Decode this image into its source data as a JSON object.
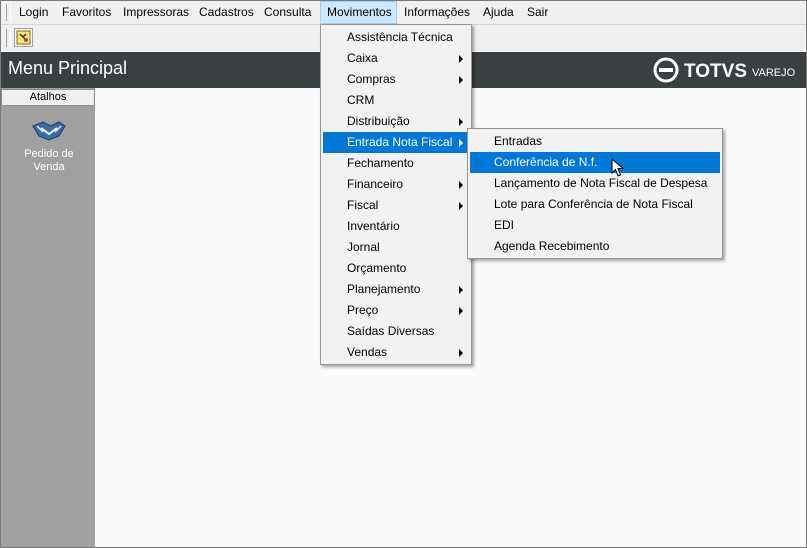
{
  "menubar": [
    {
      "label": "Login",
      "x": 0
    },
    {
      "label": "Favoritos",
      "x": 0
    },
    {
      "label": "Impressoras",
      "x": 0
    },
    {
      "label": "Cadastros",
      "x": 0
    },
    {
      "label": "Consulta",
      "x": 0
    },
    {
      "label": "Movimentos",
      "x": 0
    },
    {
      "label": "Informações",
      "x": 0
    },
    {
      "label": "Ajuda",
      "x": 0
    },
    {
      "label": "Sair",
      "x": 0
    }
  ],
  "header": {
    "title": "Menu Principal",
    "logo_text": "TOTVS",
    "logo_subtext": "VAREJO"
  },
  "sidebar": {
    "tab_label": "Atalhos",
    "shortcut_line1": "Pedido de",
    "shortcut_line2": "Venda"
  },
  "movimentos_menu": [
    {
      "label": "Assistência Técnica",
      "submenu": false
    },
    {
      "label": "Caixa",
      "submenu": true
    },
    {
      "label": "Compras",
      "submenu": true
    },
    {
      "label": "CRM",
      "submenu": false
    },
    {
      "label": "Distribuição",
      "submenu": true
    },
    {
      "label": "Entrada Nota Fiscal",
      "submenu": true,
      "selected": true
    },
    {
      "label": "Fechamento",
      "submenu": false
    },
    {
      "label": "Financeiro",
      "submenu": true
    },
    {
      "label": "Fiscal",
      "submenu": true
    },
    {
      "label": "Inventário",
      "submenu": false
    },
    {
      "label": "Jornal",
      "submenu": false
    },
    {
      "label": "Orçamento",
      "submenu": false
    },
    {
      "label": "Planejamento",
      "submenu": true
    },
    {
      "label": "Preço",
      "submenu": true
    },
    {
      "label": "Saídas Diversas",
      "submenu": false
    },
    {
      "label": "Vendas",
      "submenu": true
    }
  ],
  "entrada_submenu": [
    {
      "label": "Entradas"
    },
    {
      "label": "Conferência de N.f.",
      "highlighted": true
    },
    {
      "label": "Lançamento de Nota Fiscal de Despesa"
    },
    {
      "label": "Lote para Conferência de Nota Fiscal"
    },
    {
      "label": "EDI"
    },
    {
      "label": "Agenda Recebimento"
    }
  ],
  "colors": {
    "header_bg": "#3a3f42",
    "highlight": "#0078d7",
    "sidebar_bg": "#a0a0a0"
  }
}
